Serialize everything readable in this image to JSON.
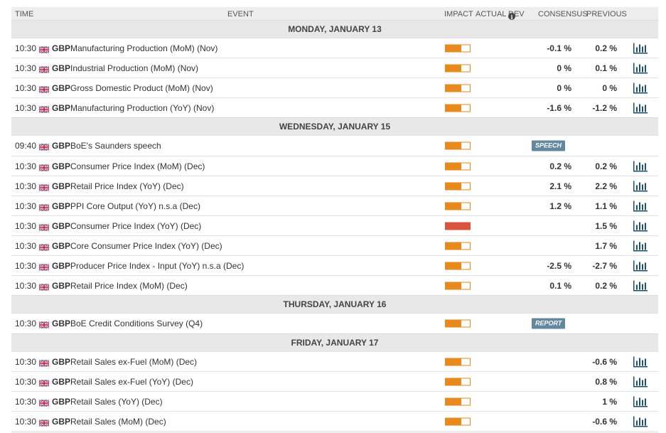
{
  "header": {
    "time": "TIME",
    "event": "EVENT",
    "impact": "IMPACT",
    "actual": "ACTUAL",
    "dev": "DEV",
    "consensus": "CONSENSUS",
    "previous": "PREVIOUS"
  },
  "colors": {
    "impact_medium": "#e8891d",
    "impact_high": "#d9533e",
    "tag": "#62889f",
    "chart_icon": "#1d4f6e"
  },
  "days": [
    {
      "label": "MONDAY, JANUARY 13",
      "events": [
        {
          "time": "10:30",
          "currency": "GBP",
          "name": "Manufacturing Production (MoM) (Nov)",
          "impact": "medium",
          "consensus": "-0.1 %",
          "previous": "0.2 %",
          "tag": "",
          "chart": true
        },
        {
          "time": "10:30",
          "currency": "GBP",
          "name": "Industrial Production (MoM) (Nov)",
          "impact": "medium",
          "consensus": "0 %",
          "previous": "0.1 %",
          "tag": "",
          "chart": true
        },
        {
          "time": "10:30",
          "currency": "GBP",
          "name": "Gross Domestic Product (MoM) (Nov)",
          "impact": "medium",
          "consensus": "0 %",
          "previous": "0 %",
          "tag": "",
          "chart": true
        },
        {
          "time": "10:30",
          "currency": "GBP",
          "name": "Manufacturing Production (YoY) (Nov)",
          "impact": "medium",
          "consensus": "-1.6 %",
          "previous": "-1.2 %",
          "tag": "",
          "chart": true
        }
      ]
    },
    {
      "label": "WEDNESDAY, JANUARY 15",
      "events": [
        {
          "time": "09:40",
          "currency": "GBP",
          "name": "BoE's Saunders speech",
          "impact": "medium",
          "consensus": "",
          "previous": "",
          "tag": "SPEECH",
          "chart": false
        },
        {
          "time": "10:30",
          "currency": "GBP",
          "name": "Consumer Price Index (MoM) (Dec)",
          "impact": "medium",
          "consensus": "0.2 %",
          "previous": "0.2 %",
          "tag": "",
          "chart": true
        },
        {
          "time": "10:30",
          "currency": "GBP",
          "name": "Retail Price Index (YoY) (Dec)",
          "impact": "medium",
          "consensus": "2.1 %",
          "previous": "2.2 %",
          "tag": "",
          "chart": true
        },
        {
          "time": "10:30",
          "currency": "GBP",
          "name": "PPI Core Output (YoY) n.s.a (Dec)",
          "impact": "medium",
          "consensus": "1.2 %",
          "previous": "1.1 %",
          "tag": "",
          "chart": true
        },
        {
          "time": "10:30",
          "currency": "GBP",
          "name": "Consumer Price Index (YoY) (Dec)",
          "impact": "high",
          "consensus": "",
          "previous": "1.5 %",
          "tag": "",
          "chart": true
        },
        {
          "time": "10:30",
          "currency": "GBP",
          "name": "Core Consumer Price Index (YoY) (Dec)",
          "impact": "medium",
          "consensus": "",
          "previous": "1.7 %",
          "tag": "",
          "chart": true
        },
        {
          "time": "10:30",
          "currency": "GBP",
          "name": "Producer Price Index - Input (YoY) n.s.a (Dec)",
          "impact": "medium",
          "consensus": "-2.5 %",
          "previous": "-2.7 %",
          "tag": "",
          "chart": true
        },
        {
          "time": "10:30",
          "currency": "GBP",
          "name": "Retail Price Index (MoM) (Dec)",
          "impact": "medium",
          "consensus": "0.1 %",
          "previous": "0.2 %",
          "tag": "",
          "chart": true
        }
      ]
    },
    {
      "label": "THURSDAY, JANUARY 16",
      "events": [
        {
          "time": "10:30",
          "currency": "GBP",
          "name": "BoE Credit Conditions Survey (Q4)",
          "impact": "medium",
          "consensus": "",
          "previous": "",
          "tag": "REPORT",
          "chart": false
        }
      ]
    },
    {
      "label": "FRIDAY, JANUARY 17",
      "events": [
        {
          "time": "10:30",
          "currency": "GBP",
          "name": "Retail Sales ex-Fuel (MoM) (Dec)",
          "impact": "medium",
          "consensus": "",
          "previous": "-0.6 %",
          "tag": "",
          "chart": true
        },
        {
          "time": "10:30",
          "currency": "GBP",
          "name": "Retail Sales ex-Fuel (YoY) (Dec)",
          "impact": "medium",
          "consensus": "",
          "previous": "0.8 %",
          "tag": "",
          "chart": true
        },
        {
          "time": "10:30",
          "currency": "GBP",
          "name": "Retail Sales (YoY) (Dec)",
          "impact": "medium",
          "consensus": "",
          "previous": "1 %",
          "tag": "",
          "chart": true
        },
        {
          "time": "10:30",
          "currency": "GBP",
          "name": "Retail Sales (MoM) (Dec)",
          "impact": "medium",
          "consensus": "",
          "previous": "-0.6 %",
          "tag": "",
          "chart": true
        }
      ]
    }
  ]
}
